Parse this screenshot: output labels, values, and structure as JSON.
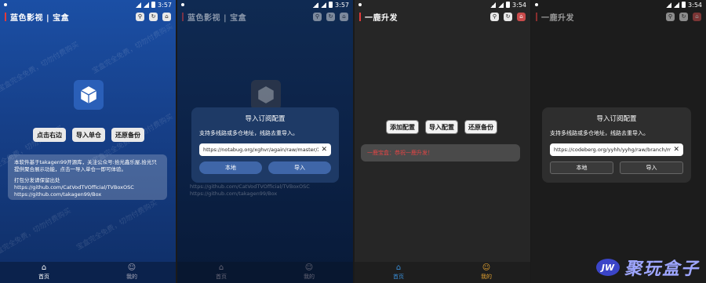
{
  "screens": [
    {
      "time": "3:57",
      "title": "蓝色影视 | 宝盒",
      "buttons": [
        "点击右边",
        "导入单仓",
        "还原备份"
      ],
      "info": {
        "line1": "本软件基于takagen99开源库，关注公众号:拾光鑫乐屋,拾光只提供聚合展示功能，点击一导入单仓一即可体验。",
        "line2": "打包分发请保留出处",
        "line3": "https://github.com/CatVodTVOfficial/TVBoxOSC",
        "line4": "https://github.com/takagen99/Box"
      },
      "watermark": "宝盒完全免费，切勿付费购买",
      "tabs": [
        "首页",
        "我的"
      ]
    },
    {
      "time": "3:57",
      "title": "蓝色影视 | 宝盒",
      "dialog": {
        "title": "导入订阅配置",
        "message": "支持多线路或多仓地址，线路去重导入。",
        "input": "https://notabug.org/xghvr/again/raw/master/Xbox",
        "left": "本地",
        "right": "导入"
      },
      "bg_lines": [
        "https://github.com/CatVodTVOfficial/TVBoxOSC",
        "https://github.com/takagen99/Box"
      ],
      "tabs": [
        "首页",
        "我的"
      ]
    },
    {
      "time": "3:54",
      "title": "一鹿升发",
      "buttons": [
        "添加配置",
        "导入配置",
        "还原备份"
      ],
      "notice": "一鹿宝盒：恭祝一鹿升发！",
      "tabs": [
        "首页",
        "我的"
      ]
    },
    {
      "time": "3:54",
      "title": "一鹿升发",
      "dialog": {
        "title": "导入订阅配置",
        "message": "支持多线路或多仓地址，线路去重导入。",
        "input": "https://codeberg.org/yyhh/yyhg/raw/branch/maste",
        "left": "本地",
        "right": "导入"
      }
    }
  ],
  "brand": {
    "badge": "JW",
    "text": "聚玩盒子"
  },
  "colors": {
    "accent_red": "#e23b3b",
    "tab_active_gold": "#e0a030",
    "blue_bg": "#1b4fa5"
  }
}
